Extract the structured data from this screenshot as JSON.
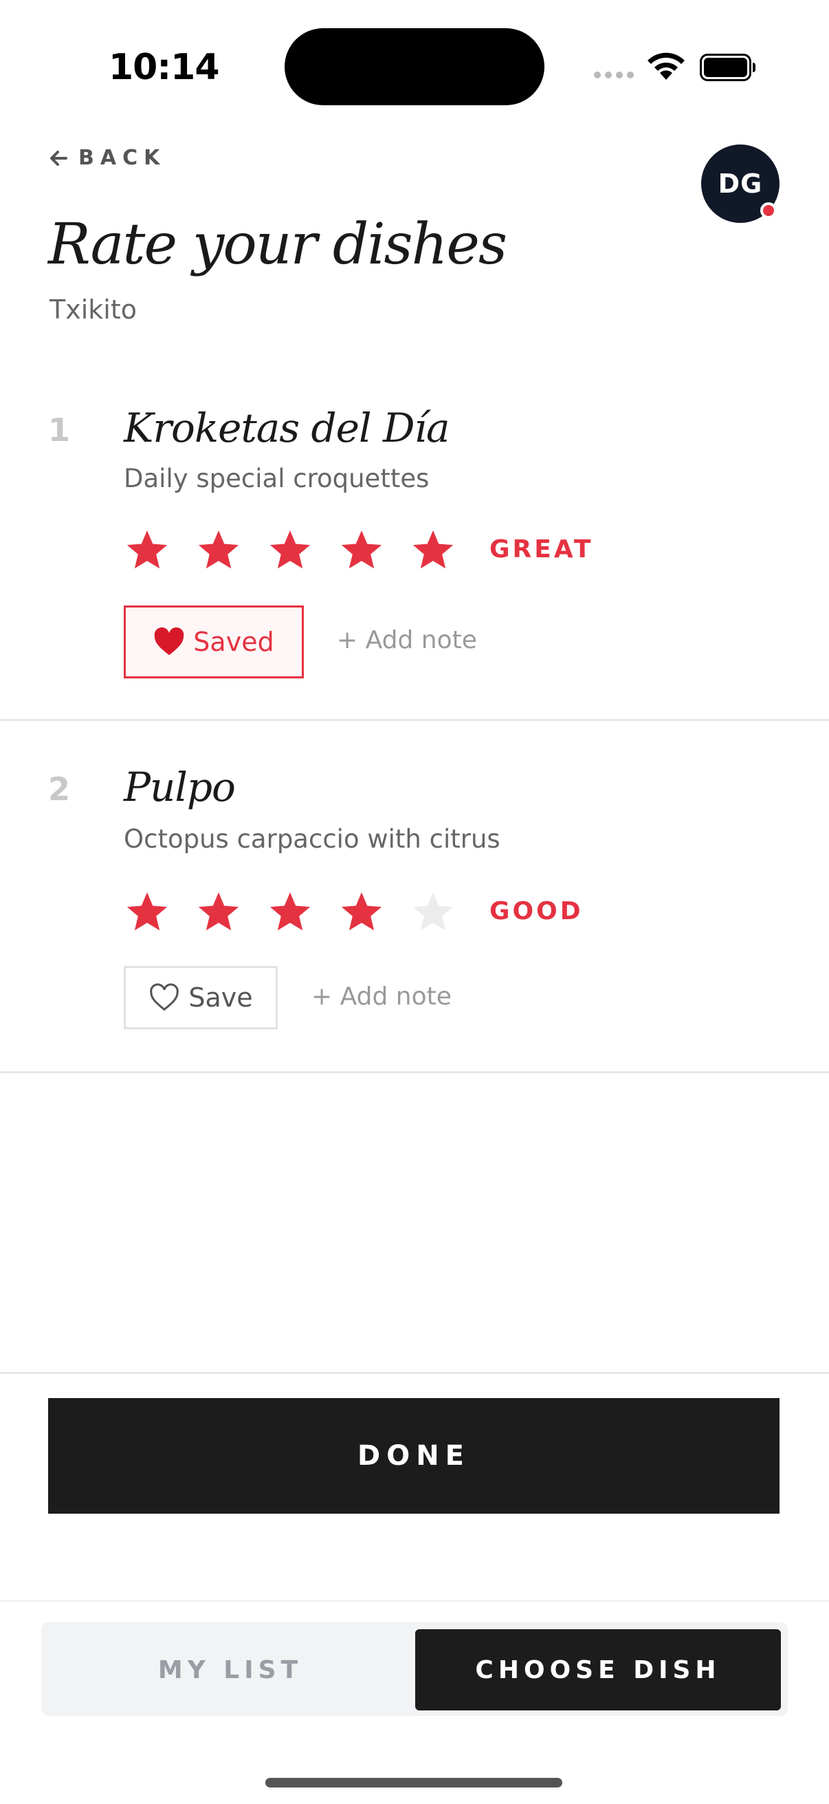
{
  "status_bar": {
    "time": "10:14"
  },
  "header": {
    "back_label": "BACK",
    "avatar_initials": "DG",
    "title": "Rate your dishes",
    "restaurant": "Txikito"
  },
  "dishes": [
    {
      "number": "1",
      "name": "Kroketas del Día",
      "description": "Daily special croquettes",
      "rating": 5,
      "max_rating": 5,
      "rating_label": "GREAT",
      "save_label": "Saved",
      "saved": true,
      "add_note_label": "+ Add note"
    },
    {
      "number": "2",
      "name": "Pulpo",
      "description": "Octopus carpaccio with citrus",
      "rating": 4,
      "max_rating": 5,
      "rating_label": "GOOD",
      "save_label": "Save",
      "saved": false,
      "add_note_label": "+ Add note"
    }
  ],
  "done_label": "DONE",
  "tabs": [
    {
      "label": "MY LIST",
      "active": false
    },
    {
      "label": "CHOOSE DISH",
      "active": true
    }
  ],
  "colors": {
    "accent": "#e53241",
    "star_inactive": "#ececec",
    "dark": "#1c1c1c",
    "avatar_bg": "#111827"
  }
}
